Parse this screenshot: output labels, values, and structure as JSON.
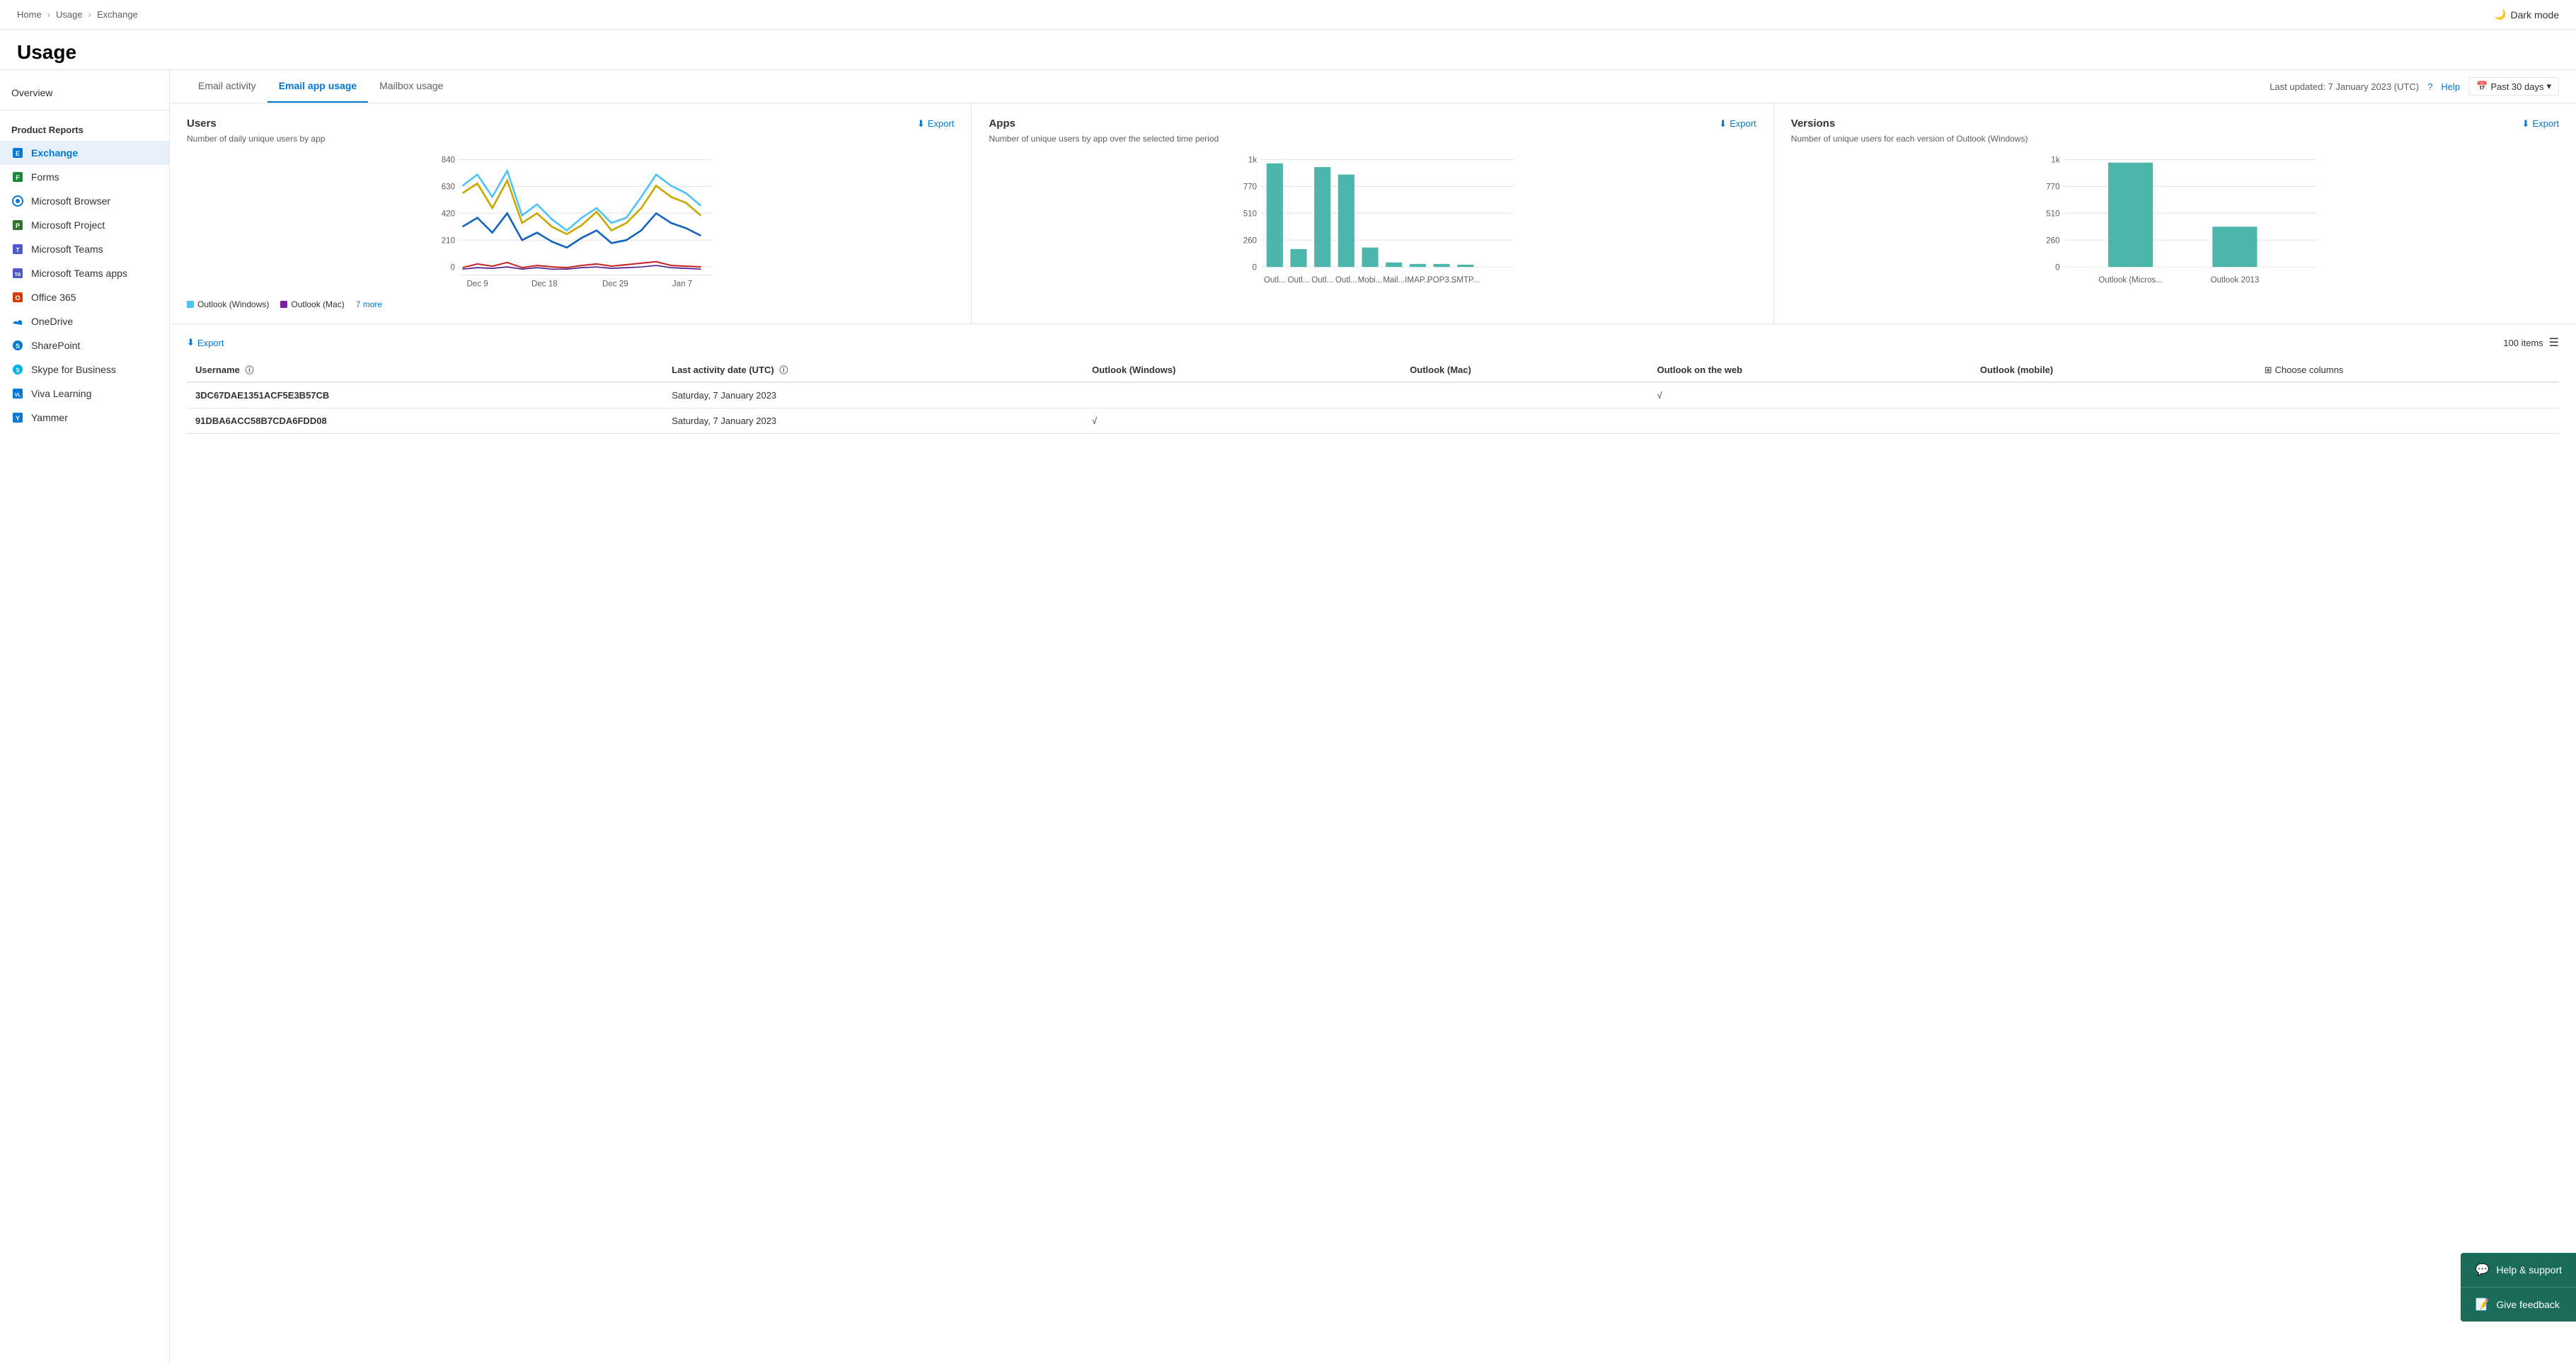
{
  "breadcrumb": {
    "items": [
      "Home",
      "Usage",
      "Exchange"
    ],
    "separators": [
      "›",
      "›"
    ]
  },
  "dark_mode": {
    "label": "Dark mode"
  },
  "page_title": "Usage",
  "sidebar": {
    "overview_label": "Overview",
    "section_title": "Product Reports",
    "items": [
      {
        "id": "exchange",
        "label": "Exchange",
        "icon": "🔷",
        "active": true
      },
      {
        "id": "forms",
        "label": "Forms",
        "icon": "🟩"
      },
      {
        "id": "microsoft-browser",
        "label": "Microsoft Browser",
        "icon": "🌐"
      },
      {
        "id": "microsoft-project",
        "label": "Microsoft Project",
        "icon": "📊"
      },
      {
        "id": "microsoft-teams",
        "label": "Microsoft Teams",
        "icon": "👥"
      },
      {
        "id": "microsoft-teams-apps",
        "label": "Microsoft Teams apps",
        "icon": "🟦"
      },
      {
        "id": "office-365",
        "label": "Office 365",
        "icon": "🔴"
      },
      {
        "id": "onedrive",
        "label": "OneDrive",
        "icon": "☁️"
      },
      {
        "id": "sharepoint",
        "label": "SharePoint",
        "icon": "🔷"
      },
      {
        "id": "skype-for-business",
        "label": "Skype for Business",
        "icon": "💬"
      },
      {
        "id": "viva-learning",
        "label": "Viva Learning",
        "icon": "📚"
      },
      {
        "id": "yammer",
        "label": "Yammer",
        "icon": "🟡"
      }
    ]
  },
  "tabs": {
    "items": [
      {
        "id": "email-activity",
        "label": "Email activity",
        "active": false
      },
      {
        "id": "email-app-usage",
        "label": "Email app usage",
        "active": true
      },
      {
        "id": "mailbox-usage",
        "label": "Mailbox usage",
        "active": false
      }
    ],
    "last_updated": "Last updated: 7 January 2023 (UTC)",
    "help_label": "Help",
    "period_label": "Past 30 days"
  },
  "charts": {
    "users": {
      "title": "Users",
      "export_label": "Export",
      "subtitle": "Number of daily unique users by app",
      "y_labels": [
        "840",
        "630",
        "420",
        "210",
        "0"
      ],
      "x_labels": [
        "Dec 9",
        "Dec 18",
        "Dec 29",
        "Jan 7"
      ],
      "legend": [
        {
          "label": "Outlook (Windows)",
          "color": "#4fc3f7"
        },
        {
          "label": "Outlook (Mac)",
          "color": "#7b1fa2"
        }
      ],
      "more_label": "7 more"
    },
    "apps": {
      "title": "Apps",
      "export_label": "Export",
      "subtitle": "Number of unique users by app over the selected time period",
      "y_labels": [
        "1k",
        "770",
        "510",
        "260",
        "0"
      ],
      "x_labels": [
        "Outl...",
        "Outl...",
        "Outl...",
        "Outl...",
        "Mobi...",
        "Mail...",
        "IMAP...",
        "POP3...",
        "SMTP..."
      ]
    },
    "versions": {
      "title": "Versions",
      "export_label": "Export",
      "subtitle": "Number of unique users for each version of Outlook (Windows)",
      "y_labels": [
        "1k",
        "770",
        "510",
        "260",
        "0"
      ],
      "x_labels": [
        "Outlook (Micros...",
        "Outlook 2013"
      ]
    }
  },
  "table": {
    "export_label": "Export",
    "items_count": "100 items",
    "columns": [
      {
        "id": "username",
        "label": "Username",
        "info": true
      },
      {
        "id": "last-activity",
        "label": "Last activity date (UTC)",
        "info": true
      },
      {
        "id": "outlook-windows",
        "label": "Outlook (Windows)"
      },
      {
        "id": "outlook-mac",
        "label": "Outlook (Mac)"
      },
      {
        "id": "outlook-web",
        "label": "Outlook on the web"
      },
      {
        "id": "outlook-mobile",
        "label": "Outlook (mobile)"
      }
    ],
    "choose_columns_label": "Choose columns",
    "rows": [
      {
        "username": "3DC67DAE1351ACF5E3B57CB",
        "last_activity": "Saturday, 7 January 2023",
        "outlook_windows": "",
        "outlook_mac": "",
        "outlook_web": "√",
        "outlook_mobile": ""
      },
      {
        "username": "91DBA6ACC58B7CDA6FDD08",
        "last_activity": "Saturday, 7 January 2023",
        "outlook_windows": "√",
        "outlook_mac": "",
        "outlook_web": "",
        "outlook_mobile": ""
      }
    ]
  },
  "floating_panel": {
    "help_label": "Help & support",
    "feedback_label": "Give feedback"
  }
}
